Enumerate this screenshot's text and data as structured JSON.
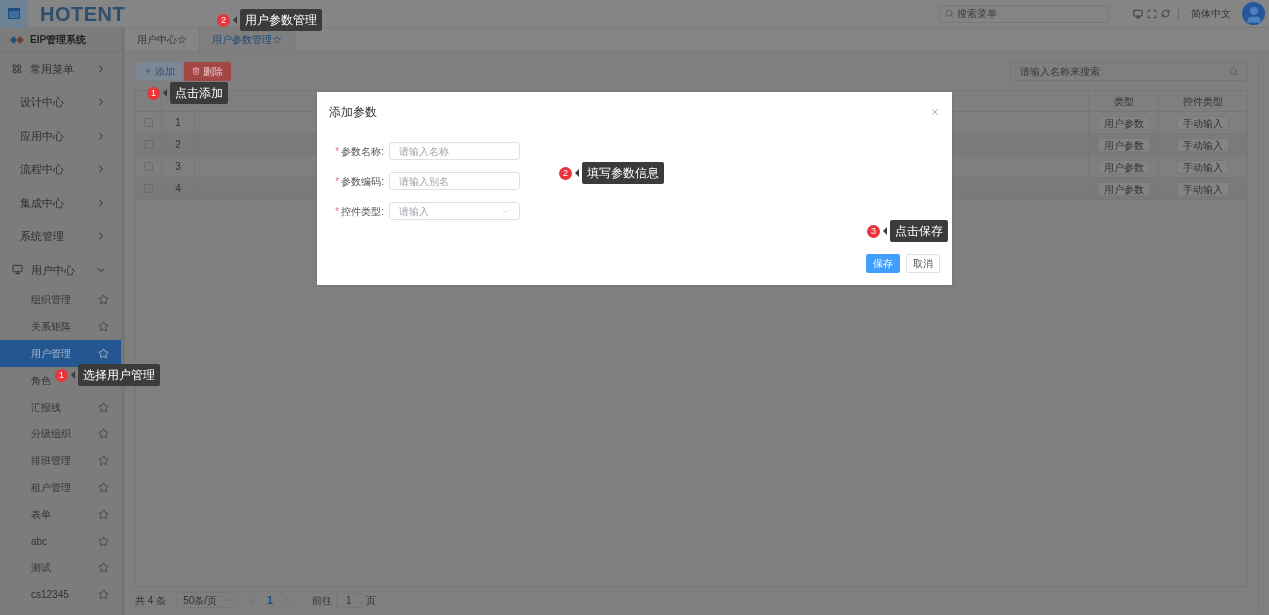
{
  "header": {
    "logo": "HOTENT",
    "search_placeholder": "搜索菜单",
    "language": "简体中文"
  },
  "sidebar": {
    "system_title": "EIP管理系统",
    "items": [
      {
        "label": "常用菜单",
        "kind": "favorites",
        "expanded": false
      },
      {
        "label": "设计中心",
        "kind": "plain",
        "expanded": false
      },
      {
        "label": "应用中心",
        "kind": "plain",
        "expanded": false
      },
      {
        "label": "流程中心",
        "kind": "plain",
        "expanded": false
      },
      {
        "label": "集成中心",
        "kind": "plain",
        "expanded": false
      },
      {
        "label": "系统管理",
        "kind": "plain",
        "expanded": false
      },
      {
        "label": "用户中心",
        "kind": "monitor",
        "expanded": true,
        "children": [
          {
            "label": "组织管理",
            "kind": "starred",
            "selected": false
          },
          {
            "label": "关系矩阵",
            "kind": "starred",
            "selected": false
          },
          {
            "label": "用户管理",
            "kind": "starred",
            "selected": true
          },
          {
            "label": "角色",
            "kind": "plain",
            "selected": false
          },
          {
            "label": "汇报线",
            "kind": "starred",
            "selected": false
          },
          {
            "label": "分级组织",
            "kind": "starred",
            "selected": false
          },
          {
            "label": "排班管理",
            "kind": "starred",
            "selected": false
          },
          {
            "label": "租户管理",
            "kind": "starred",
            "selected": false
          },
          {
            "label": "表单",
            "kind": "starred",
            "selected": false
          },
          {
            "label": "abc",
            "kind": "starred",
            "selected": false
          },
          {
            "label": "测试",
            "kind": "starred",
            "selected": false
          },
          {
            "label": "cs12345",
            "kind": "starred",
            "selected": false
          }
        ]
      }
    ]
  },
  "tabs": [
    {
      "label": "用户中心☆",
      "selected": false
    },
    {
      "label": "用户参数管理☆",
      "selected": true
    }
  ],
  "toolbar": {
    "buttons": [
      {
        "label": "添加",
        "kind": "add"
      },
      {
        "label": "删除",
        "kind": "delete"
      }
    ],
    "search_placeholder": "请输入名称来搜索"
  },
  "table": {
    "columns": [
      "类型",
      "控件类型"
    ],
    "rows": [
      {
        "index": "1",
        "type": "用户参数",
        "control": "手动输入",
        "checked": false
      },
      {
        "index": "2",
        "type": "用户参数",
        "control": "手动输入",
        "checked": false
      },
      {
        "index": "3",
        "type": "用户参数",
        "control": "手动输入",
        "checked": false
      },
      {
        "index": "4",
        "type": "用户参数",
        "control": "手动输入",
        "checked": false
      }
    ]
  },
  "pagination": {
    "total": "共 4 条",
    "page_size": "50条/页",
    "current": "1",
    "goto_label": "前往",
    "goto_value": "1",
    "page_suffix": "页"
  },
  "dialog": {
    "title": "添加参数",
    "fields": [
      {
        "label": "参数名称:",
        "placeholder": "请输入名称",
        "kind": "input",
        "required_mark": "*"
      },
      {
        "label": "参数编码:",
        "placeholder": "请输入别名",
        "kind": "input",
        "required_mark": "*"
      },
      {
        "label": "控件类型:",
        "placeholder": "请输入",
        "kind": "select",
        "required_mark": "*"
      }
    ],
    "buttons": [
      {
        "label": "保存",
        "kind": "primary"
      },
      {
        "label": "取消",
        "kind": "default"
      }
    ]
  },
  "callouts": [
    {
      "number": "2",
      "text": "用户参数管理"
    },
    {
      "number": "1",
      "text": "点击添加"
    },
    {
      "number": "2",
      "text": "填写参数信息"
    },
    {
      "number": "3",
      "text": "点击保存"
    },
    {
      "number": "1",
      "text": "选择用户管理"
    }
  ]
}
